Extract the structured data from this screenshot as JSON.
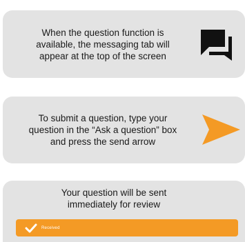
{
  "cards": [
    {
      "text": "When the question function is\navailable, the messaging tab will\nappear at the top of the screen",
      "icon": "chat-bubbles-icon"
    },
    {
      "text": "To submit a question, type your\nquestion in the “Ask a question” box\nand press the send arrow",
      "icon": "send-arrow-icon"
    },
    {
      "text": "Your question will be sent\nimmediately for review"
    }
  ],
  "received_bar": {
    "label": "Received",
    "icon": "checkmark-icon"
  },
  "colors": {
    "card_background": "#e3e3e3",
    "accent_orange": "#f49a25",
    "icon_dark": "#111111",
    "text": "#1a1a1a"
  }
}
